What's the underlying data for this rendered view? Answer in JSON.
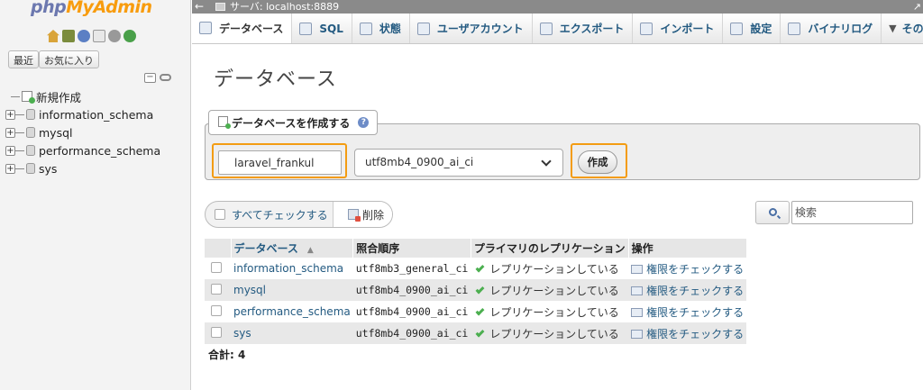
{
  "app": {
    "logo_part1": "php",
    "logo_part2": "MyAdmin",
    "recent_label": "最近",
    "favorites_label": "お気に入り"
  },
  "navigation": {
    "new_item": "新規作成",
    "databases": [
      "information_schema",
      "mysql",
      "performance_schema",
      "sys"
    ]
  },
  "breadcrumb": {
    "server": "サーバ: localhost:8889"
  },
  "tabs": [
    {
      "label": "データベース",
      "icon": "database-icon",
      "active": true
    },
    {
      "label": "SQL",
      "icon": "sql-icon",
      "active": false
    },
    {
      "label": "状態",
      "icon": "status-icon",
      "active": false
    },
    {
      "label": "ユーザアカウント",
      "icon": "user-accounts-icon",
      "active": false
    },
    {
      "label": "エクスポート",
      "icon": "export-icon",
      "active": false
    },
    {
      "label": "インポート",
      "icon": "import-icon",
      "active": false
    },
    {
      "label": "設定",
      "icon": "settings-icon",
      "active": false
    },
    {
      "label": "バイナリログ",
      "icon": "binary-log-icon",
      "active": false
    },
    {
      "label": "その",
      "icon": "more-chevron-icon",
      "active": false
    }
  ],
  "main": {
    "title": "データベース",
    "create_db": {
      "legend": "データベースを作成する",
      "name_value": "laravel_frankul",
      "collation_selected": "utf8mb4_0900_ai_ci",
      "create_button": "作成"
    },
    "check_all_label": "すべてチェックする",
    "delete_label": "削除",
    "search_placeholder": "検索",
    "table": {
      "headers": [
        "データベース",
        "照合順序",
        "プライマリのレプリケーション",
        "操作"
      ],
      "rows": [
        {
          "name": "information_schema",
          "collation": "utf8mb3_general_ci",
          "replication": "レプリケーションしている",
          "action": "権限をチェックする"
        },
        {
          "name": "mysql",
          "collation": "utf8mb4_0900_ai_ci",
          "replication": "レプリケーションしている",
          "action": "権限をチェックする"
        },
        {
          "name": "performance_schema",
          "collation": "utf8mb4_0900_ai_ci",
          "replication": "レプリケーションしている",
          "action": "権限をチェックする"
        },
        {
          "name": "sys",
          "collation": "utf8mb4_0900_ai_ci",
          "replication": "レプリケーションしている",
          "action": "権限をチェックする"
        }
      ]
    },
    "total": "合計: 4"
  },
  "colors": {
    "link": "#235a81",
    "highlight": "#f39c12",
    "logo_blue": "#6c78af",
    "logo_orange": "#f89c0e",
    "check_green": "#4caf50"
  }
}
